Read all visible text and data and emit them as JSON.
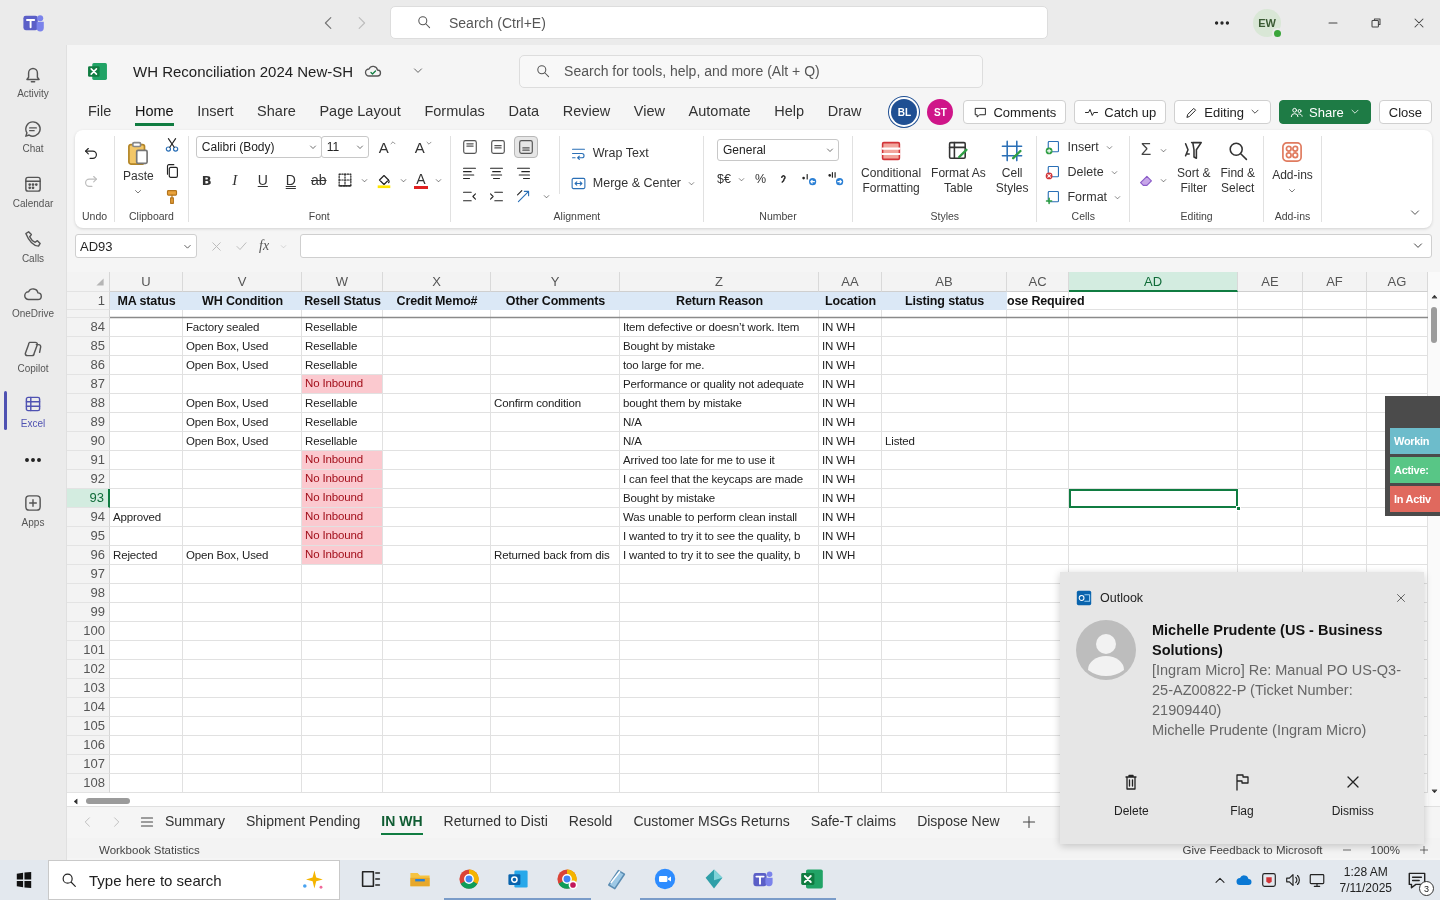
{
  "app_bar": {
    "search_placeholder": "Search (Ctrl+E)",
    "avatar": "EW",
    "online": true
  },
  "rail": {
    "apps": [
      {
        "label": "Activity",
        "selected": false
      },
      {
        "label": "Chat",
        "selected": false
      },
      {
        "label": "Calendar",
        "selected": false
      },
      {
        "label": "Calls",
        "selected": false
      },
      {
        "label": "OneDrive",
        "selected": false
      },
      {
        "label": "Copilot",
        "selected": false
      },
      {
        "label": "Excel",
        "selected": true
      }
    ],
    "extra": [
      {
        "label": "Apps",
        "selected": false
      }
    ]
  },
  "workbook": {
    "title": "WH Reconciliation 2024 New-SH",
    "search_placeholder": "Search for tools, help, and more (Alt + Q)"
  },
  "menu_tabs": [
    {
      "label": "File",
      "selected": false
    },
    {
      "label": "Home",
      "selected": true
    },
    {
      "label": "Insert",
      "selected": false
    },
    {
      "label": "Share",
      "selected": false
    },
    {
      "label": "Page Layout",
      "selected": false
    },
    {
      "label": "Formulas",
      "selected": false
    },
    {
      "label": "Data",
      "selected": false
    },
    {
      "label": "Review",
      "selected": false
    },
    {
      "label": "View",
      "selected": false
    },
    {
      "label": "Automate",
      "selected": false
    },
    {
      "label": "Help",
      "selected": false
    },
    {
      "label": "Draw",
      "selected": false
    }
  ],
  "collaborators": [
    {
      "initials": "BL",
      "color": "#1f4f93"
    },
    {
      "initials": "ST",
      "color": "#cf1589"
    }
  ],
  "actions": [
    {
      "label": "Comments",
      "kind": "outline",
      "dropdown": false
    },
    {
      "label": "Catch up",
      "kind": "outline",
      "dropdown": false
    },
    {
      "label": "Editing",
      "kind": "outline",
      "dropdown": true
    },
    {
      "label": "Share",
      "kind": "primary",
      "dropdown": true
    },
    {
      "label": "Close",
      "kind": "outline",
      "dropdown": false
    }
  ],
  "ribbon": [
    {
      "kind": "undo",
      "label": "Undo",
      "redo_disabled": true
    },
    {
      "kind": "clipboard",
      "label": "Clipboard",
      "paste": "Paste"
    },
    {
      "kind": "font",
      "label": "Font",
      "font": "Calibri (Body)",
      "size": "11",
      "grow": "A",
      "shrink": "A",
      "styles": [
        "B",
        "I",
        "U",
        "D",
        "ab"
      ],
      "font_color": "A"
    },
    {
      "kind": "alignment",
      "label": "Alignment",
      "vertical": [
        {
          "selected": false
        },
        {
          "selected": false
        },
        {
          "selected": true
        }
      ],
      "wrap": "Wrap Text",
      "merge": "Merge & Center"
    },
    {
      "kind": "number",
      "label": "Number",
      "format": "General",
      "currency": "$€",
      "percent": "%"
    },
    {
      "kind": "styles",
      "label": "Styles",
      "buttons": [
        {
          "lines": [
            "Conditional",
            "Formatting"
          ]
        },
        {
          "lines": [
            "Format As",
            "Table"
          ]
        },
        {
          "lines": [
            "Cell",
            "Styles"
          ]
        }
      ]
    },
    {
      "kind": "cells",
      "label": "Cells",
      "buttons": [
        "Insert",
        "Delete",
        "Format"
      ]
    },
    {
      "kind": "editing",
      "label": "Editing",
      "sum": "Σ",
      "buttons": [
        {
          "lines": [
            "Sort &",
            "Filter"
          ]
        },
        {
          "lines": [
            "Find &",
            "Select"
          ]
        }
      ]
    },
    {
      "kind": "addins",
      "label": "Add-ins",
      "button": "Add-ins"
    }
  ],
  "formula_bar": {
    "name_box": "AD93",
    "fx": "fx"
  },
  "sheet": {
    "columns": [
      {
        "letter": "U",
        "header": "MA status",
        "filled": true,
        "selected": false
      },
      {
        "letter": "V",
        "header": "WH Condition",
        "filled": true,
        "selected": false
      },
      {
        "letter": "W",
        "header": "Resell Status",
        "filled": true,
        "selected": false
      },
      {
        "letter": "X",
        "header": "Credit Memo#",
        "filled": true,
        "selected": false
      },
      {
        "letter": "Y",
        "header": "Other Comments",
        "filled": true,
        "selected": false
      },
      {
        "letter": "Z",
        "header": "Return Reason",
        "filled": true,
        "selected": false
      },
      {
        "letter": "AA",
        "header": "Location",
        "filled": true,
        "selected": false
      },
      {
        "letter": "AB",
        "header": "Listing status",
        "filled": true,
        "selected": false
      },
      {
        "letter": "AC",
        "header": "ose Required",
        "selected": false
      },
      {
        "letter": "AD",
        "selected": true
      },
      {
        "letter": "AE",
        "selected": false
      },
      {
        "letter": "AF",
        "selected": false
      },
      {
        "letter": "AG",
        "selected": false
      }
    ],
    "header_row": "1",
    "rows": [
      {
        "number": "84",
        "selected": false,
        "cells": {
          "V": {
            "text": "Factory sealed",
            "highlight": false
          },
          "W": {
            "text": "Resellable",
            "highlight": false
          },
          "Z": {
            "text": "Item defective or doesn’t work. Item",
            "highlight": false
          },
          "AA": {
            "text": "IN WH",
            "highlight": false
          }
        }
      },
      {
        "number": "85",
        "selected": false,
        "cells": {
          "V": {
            "text": "Open Box, Used",
            "highlight": false
          },
          "W": {
            "text": "Resellable",
            "highlight": false
          },
          "Z": {
            "text": "Bought by mistake",
            "highlight": false
          },
          "AA": {
            "text": "IN WH",
            "highlight": false
          }
        }
      },
      {
        "number": "86",
        "selected": false,
        "cells": {
          "V": {
            "text": "Open Box, Used",
            "highlight": false
          },
          "W": {
            "text": "Resellable",
            "highlight": false
          },
          "Z": {
            "text": "too large for me.",
            "highlight": false
          },
          "AA": {
            "text": "IN WH",
            "highlight": false
          }
        }
      },
      {
        "number": "87",
        "selected": false,
        "cells": {
          "W": {
            "text": "No Inbound",
            "highlight": true
          },
          "Z": {
            "text": "Performance or quality not adequate",
            "highlight": false
          },
          "AA": {
            "text": "IN WH",
            "highlight": false
          }
        }
      },
      {
        "number": "88",
        "selected": false,
        "cells": {
          "V": {
            "text": "Open Box, Used",
            "highlight": false
          },
          "W": {
            "text": "Resellable",
            "highlight": false
          },
          "Y": {
            "text": "Confirm condition",
            "highlight": false
          },
          "Z": {
            "text": "bought them by mistake",
            "highlight": false
          },
          "AA": {
            "text": "IN WH",
            "highlight": false
          }
        }
      },
      {
        "number": "89",
        "selected": false,
        "cells": {
          "V": {
            "text": "Open Box, Used",
            "highlight": false
          },
          "W": {
            "text": "Resellable",
            "highlight": false
          },
          "Z": {
            "text": "N/A",
            "highlight": false
          },
          "AA": {
            "text": "IN WH",
            "highlight": false
          }
        }
      },
      {
        "number": "90",
        "selected": false,
        "cells": {
          "V": {
            "text": "Open Box, Used",
            "highlight": false
          },
          "W": {
            "text": "Resellable",
            "highlight": false
          },
          "Z": {
            "text": "N/A",
            "highlight": false
          },
          "AA": {
            "text": "IN WH",
            "highlight": false
          },
          "AB": {
            "text": "Listed",
            "highlight": false
          }
        }
      },
      {
        "number": "91",
        "selected": false,
        "cells": {
          "W": {
            "text": "No Inbound",
            "highlight": true
          },
          "Z": {
            "text": "Arrived too late for me to use it",
            "highlight": false
          },
          "AA": {
            "text": "IN WH",
            "highlight": false
          }
        }
      },
      {
        "number": "92",
        "selected": false,
        "cells": {
          "W": {
            "text": "No Inbound",
            "highlight": true
          },
          "Z": {
            "text": "I can feel that the keycaps are made",
            "highlight": false
          },
          "AA": {
            "text": "IN WH",
            "highlight": false
          }
        }
      },
      {
        "number": "93",
        "selected": true,
        "cells": {
          "W": {
            "text": "No Inbound",
            "highlight": true
          },
          "Z": {
            "text": "Bought by mistake",
            "highlight": false
          },
          "AA": {
            "text": "IN WH",
            "highlight": false
          }
        }
      },
      {
        "number": "94",
        "selected": false,
        "cells": {
          "U": {
            "text": "Approved",
            "highlight": false
          },
          "W": {
            "text": "No Inbound",
            "highlight": true
          },
          "Z": {
            "text": "Was unable to perform clean install",
            "highlight": false
          },
          "AA": {
            "text": "IN WH",
            "highlight": false
          }
        }
      },
      {
        "number": "95",
        "selected": false,
        "cells": {
          "W": {
            "text": "No Inbound",
            "highlight": true
          },
          "Z": {
            "text": "I wanted to try it to see the quality, b",
            "highlight": false
          },
          "AA": {
            "text": "IN WH",
            "highlight": false
          }
        }
      },
      {
        "number": "96",
        "selected": false,
        "cells": {
          "U": {
            "text": "Rejected",
            "highlight": false
          },
          "V": {
            "text": "Open Box, Used",
            "highlight": false
          },
          "W": {
            "text": "No Inbound",
            "highlight": true
          },
          "Y": {
            "text": "Returned back from dis",
            "highlight": false
          },
          "Z": {
            "text": "I wanted to try it to see the quality, b",
            "highlight": false
          },
          "AA": {
            "text": "IN WH",
            "highlight": false
          }
        }
      },
      {
        "number": "97",
        "selected": false
      },
      {
        "number": "98",
        "selected": false
      },
      {
        "number": "99",
        "selected": false
      },
      {
        "number": "100",
        "selected": false
      },
      {
        "number": "101",
        "selected": false
      },
      {
        "number": "102",
        "selected": false
      },
      {
        "number": "103",
        "selected": false
      },
      {
        "number": "104",
        "selected": false
      },
      {
        "number": "105",
        "selected": false
      },
      {
        "number": "106",
        "selected": false
      },
      {
        "number": "107",
        "selected": false
      },
      {
        "number": "108",
        "selected": false
      }
    ]
  },
  "sheet_tabs": [
    {
      "label": "Summary",
      "selected": false
    },
    {
      "label": "Shipment Pending",
      "selected": false
    },
    {
      "label": "IN WH",
      "selected": true
    },
    {
      "label": "Returned to Disti",
      "selected": false
    },
    {
      "label": "Resold",
      "selected": false
    },
    {
      "label": "Customer MSGs Returns",
      "selected": false
    },
    {
      "label": "Safe-T claims",
      "selected": false
    },
    {
      "label": "Dispose New",
      "selected": false
    }
  ],
  "status_bar": {
    "left": "Workbook Statistics",
    "feedback": "Give Feedback to Microsoft",
    "zoom": "100%"
  },
  "side_widget": {
    "buttons": [
      {
        "label": "Workin",
        "color": "#6dbccb"
      },
      {
        "label": "Active:",
        "color": "#58c686"
      },
      {
        "label": "In Activ",
        "color": "#e0695e"
      }
    ]
  },
  "notification": {
    "app": "Outlook",
    "title": "Michelle Prudente (US - Business Solutions)",
    "body": "[Ingram Micro] Re: Manual PO US-Q3-25-AZ00822-P (Ticket Number: 21909440)",
    "sender": "Michelle Prudente (Ingram Micro)",
    "actions": [
      "Delete",
      "Flag",
      "Dismiss"
    ]
  },
  "taskbar": {
    "search_placeholder": "Type here to search",
    "time": "1:28 AM",
    "date": "7/11/2025",
    "notifications": "3"
  }
}
